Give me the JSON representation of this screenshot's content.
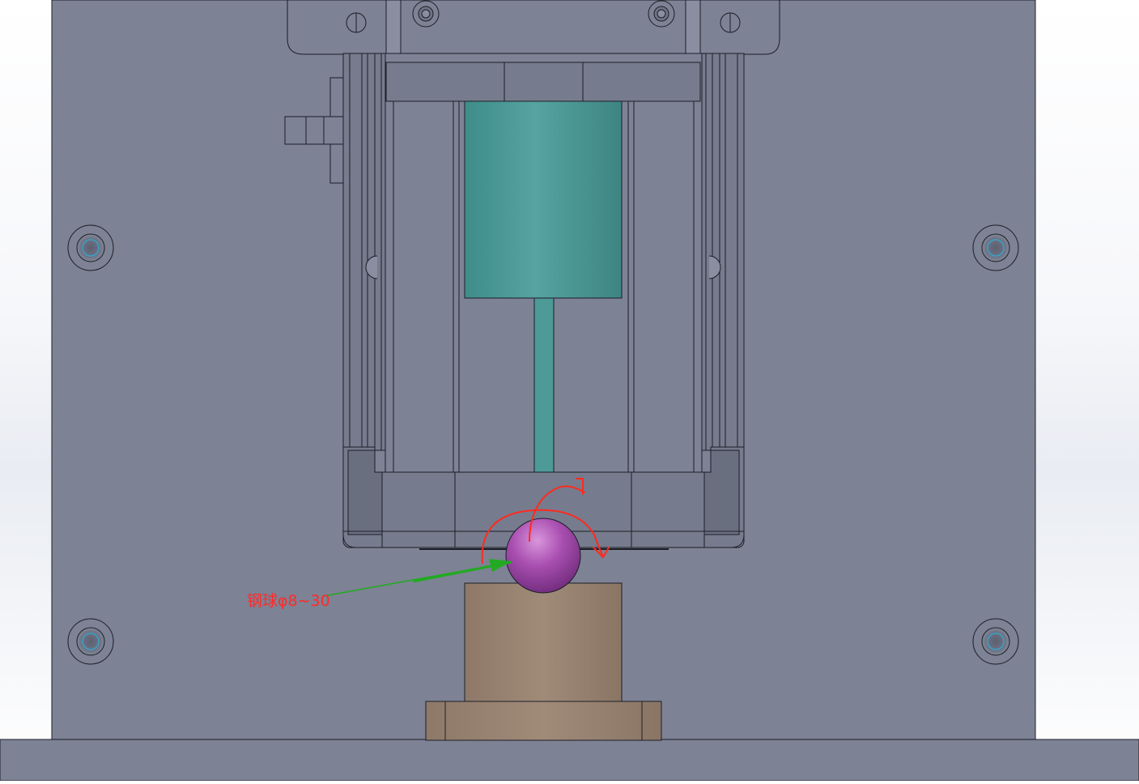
{
  "annotation": {
    "label": "钢球φ8~30"
  },
  "colors": {
    "plate": "#7d8294",
    "part_dark": "#747a8c",
    "edge": "#1c1f28",
    "motor": "#4d9a97",
    "ball": "#a04ca8",
    "fixture": "#998373",
    "leader": "#22aa22",
    "sketch": "#ff2a1e"
  }
}
